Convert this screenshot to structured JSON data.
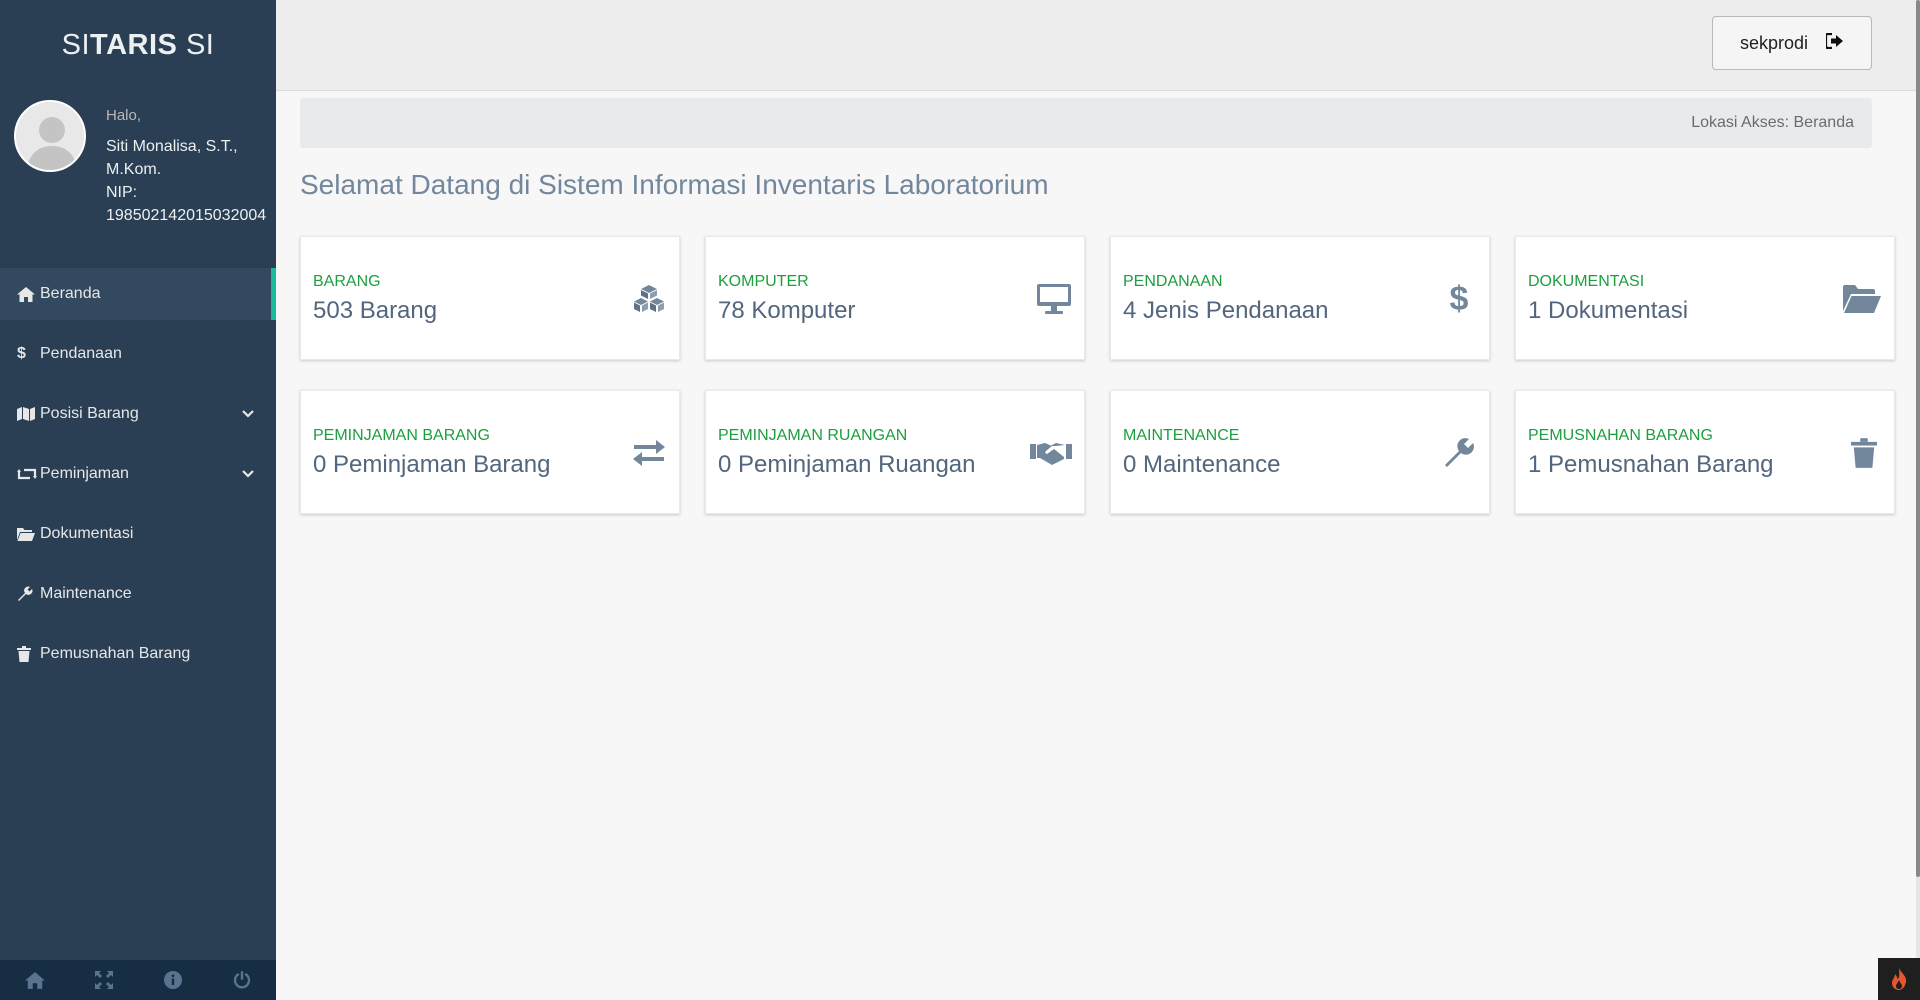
{
  "app": {
    "brand_light1": "SI",
    "brand_bold": "TARIS",
    "brand_light2": " SI"
  },
  "profile": {
    "greeting": "Halo,",
    "name": "Siti Monalisa, S.T., M.Kom.",
    "nip_label": "NIP:",
    "nip": "198502142015032004"
  },
  "sidebar": {
    "items": [
      {
        "label": "Beranda",
        "icon": "home-icon",
        "active": true
      },
      {
        "label": "Pendanaan",
        "icon": "dollar-icon"
      },
      {
        "label": "Posisi Barang",
        "icon": "map-icon",
        "has_submenu": true
      },
      {
        "label": "Peminjaman",
        "icon": "retweet-icon",
        "has_submenu": true
      },
      {
        "label": "Dokumentasi",
        "icon": "folder-open-icon"
      },
      {
        "label": "Maintenance",
        "icon": "wrench-icon"
      },
      {
        "label": "Pemusnahan Barang",
        "icon": "trash-icon"
      }
    ],
    "footer_icons": [
      "home-icon",
      "fullscreen-icon",
      "info-icon",
      "power-icon"
    ]
  },
  "topnav": {
    "user_label": "sekprodi",
    "user_icon": "sign-out-icon"
  },
  "breadcrumb": {
    "text": "Lokasi Akses: Beranda"
  },
  "page": {
    "title": "Selamat Datang di Sistem Informasi Inventaris Laboratorium"
  },
  "cards": [
    {
      "category": "BARANG",
      "value": "503 Barang",
      "icon": "cubes-icon"
    },
    {
      "category": "KOMPUTER",
      "value": "78 Komputer",
      "icon": "desktop-icon"
    },
    {
      "category": "PENDANAAN",
      "value": "4 Jenis Pendanaan",
      "icon": "dollar-icon"
    },
    {
      "category": "DOKUMENTASI",
      "value": "1 Dokumentasi",
      "icon": "folder-open-icon"
    },
    {
      "category": "PEMINJAMAN BARANG",
      "value": "0 Peminjaman Barang",
      "icon": "exchange-icon"
    },
    {
      "category": "PEMINJAMAN RUANGAN",
      "value": "0 Peminjaman Ruangan",
      "icon": "handshake-icon"
    },
    {
      "category": "MAINTENANCE",
      "value": "0 Maintenance",
      "icon": "wrench-icon"
    },
    {
      "category": "PEMUSNAHAN BARANG",
      "value": "1 Pemusnahan Barang",
      "icon": "trash-icon"
    }
  ],
  "colors": {
    "sidebar_bg": "#2a3f54",
    "active_accent": "#1abb9c",
    "card_category": "#1c9f3e",
    "card_value": "#52667d",
    "icon": "#73879c"
  }
}
